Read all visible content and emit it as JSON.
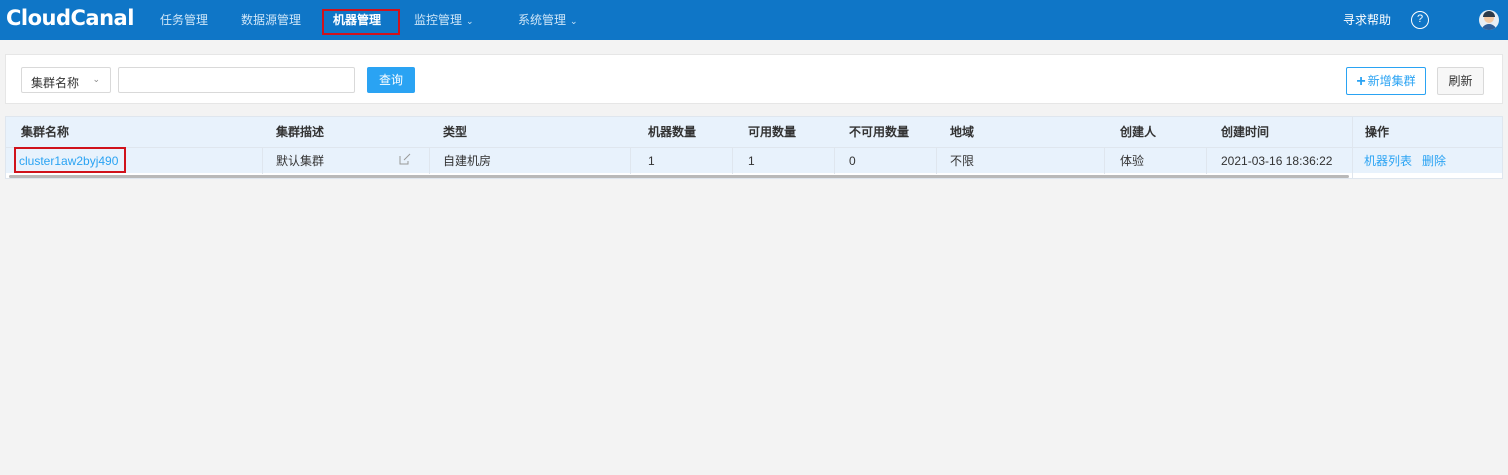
{
  "app": {
    "logo": "CloudCanal"
  },
  "nav": [
    {
      "label": "任务管理",
      "dropdown": false,
      "active": false
    },
    {
      "label": "数据源管理",
      "dropdown": false,
      "active": false
    },
    {
      "label": "机器管理",
      "dropdown": false,
      "active": true
    },
    {
      "label": "监控管理",
      "dropdown": true,
      "active": false
    },
    {
      "label": "系统管理",
      "dropdown": true,
      "active": false
    }
  ],
  "header": {
    "help_label": "寻求帮助",
    "help_icon": "question-circle-icon",
    "avatar_icon": "user-avatar-icon"
  },
  "search": {
    "field_select": "集群名称",
    "input_value": "",
    "input_placeholder": "",
    "query_label": "查询",
    "add_label": "新增集群",
    "refresh_label": "刷新"
  },
  "table": {
    "columns": [
      "集群名称",
      "集群描述",
      "类型",
      "机器数量",
      "可用数量",
      "不可用数量",
      "地域",
      "创建人",
      "创建时间",
      "操作"
    ],
    "rows": [
      {
        "name": "cluster1aw2byj490",
        "desc": "默认集群",
        "type": "自建机房",
        "machines": "1",
        "available": "1",
        "unavailable": "0",
        "region": "不限",
        "creator": "体验",
        "created": "2021-03-16 18:36:22",
        "op_list": "机器列表",
        "op_delete": "删除"
      }
    ]
  },
  "colors": {
    "topbar": "#0f76c7",
    "accent": "#2aa3f3",
    "highlight": "#d0121b",
    "row_bg": "#e8f2fc"
  }
}
